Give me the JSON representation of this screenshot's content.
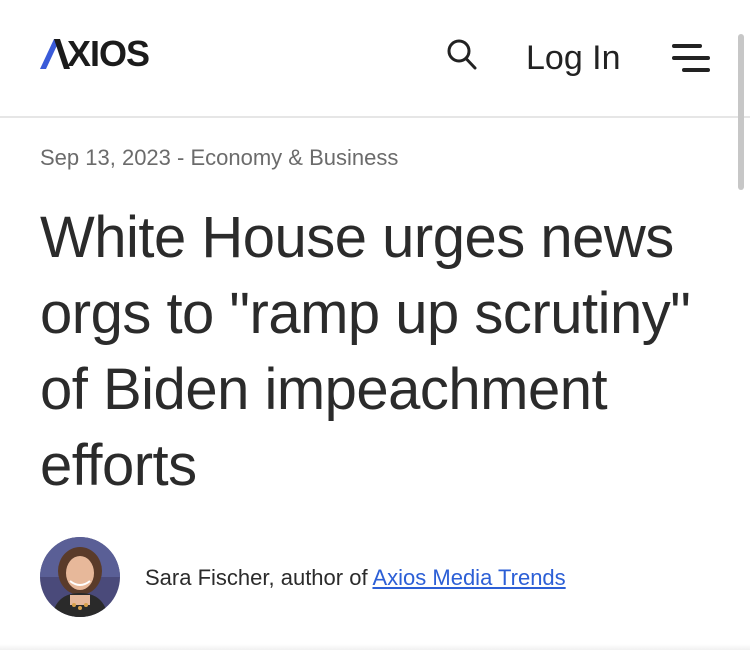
{
  "header": {
    "logo_text": "XIOS",
    "logo_name": "Axios",
    "login_label": "Log In",
    "brand_color": "#3a5bd9"
  },
  "meta": {
    "date": "Sep 13, 2023",
    "separator": " - ",
    "section": "Economy & Business"
  },
  "article": {
    "headline": "White House urges news orgs to \"ramp up scrutiny\" of Biden impeachment efforts"
  },
  "byline": {
    "author_text": "Sara Fischer, author of ",
    "newsletter_link": "Axios Media Trends",
    "link_color": "#2c5fd6"
  },
  "icons": {
    "search": "search-icon",
    "menu": "menu-icon"
  }
}
